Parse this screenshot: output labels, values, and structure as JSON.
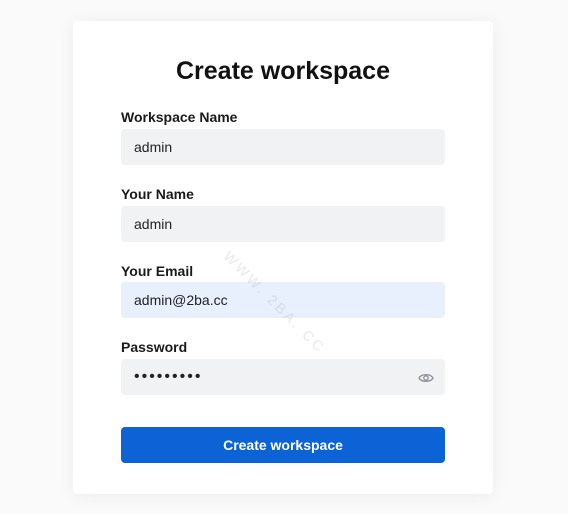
{
  "form": {
    "title": "Create workspace",
    "fields": [
      {
        "label": "Workspace Name",
        "value": "admin"
      },
      {
        "label": "Your Name",
        "value": "admin"
      },
      {
        "label": "Your Email",
        "value": "admin@2ba.cc"
      },
      {
        "label": "Password",
        "value": "•••••••••"
      }
    ],
    "submit_label": "Create workspace"
  },
  "icons": {
    "password_toggle": "eye-icon"
  },
  "watermark": "WWW. 2BA. CC",
  "colors": {
    "primary": "#0b63d6",
    "input_bg": "#f1f2f4",
    "autofill_bg": "#e8f0fe"
  }
}
